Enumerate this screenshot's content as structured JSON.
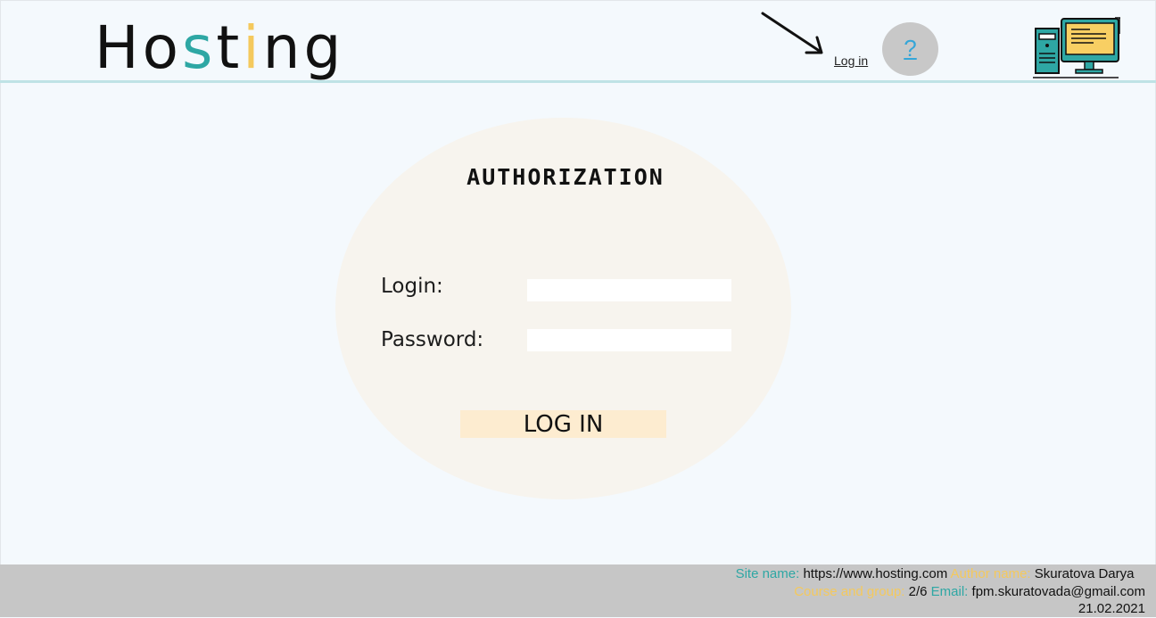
{
  "header": {
    "logo": {
      "part1": "Ho",
      "part2": "s",
      "part3": "t",
      "part4": "i",
      "part5": "ng"
    },
    "login_link": "Log in",
    "help_label": "?"
  },
  "auth": {
    "title": "AUTHORIZATION",
    "login_label": "Login:",
    "login_value": "",
    "password_label": "Password:",
    "password_value": "",
    "submit_label": "LOG IN"
  },
  "footer": {
    "site_label": "Site name:",
    "site_value": "https://www.hosting.com",
    "author_label": "Author name:",
    "author_value": "Skuratova Darya",
    "course_label": "Course and group:",
    "course_value": "2/6",
    "email_label": "Email:",
    "email_value": "fpm.skuratovada@gmail.com",
    "date": "21.02.2021"
  },
  "colors": {
    "accent_teal": "#2ea7a4",
    "accent_yellow": "#f4c95d",
    "help_link_blue": "#35a6d8",
    "submit_bg": "#fdecd0"
  },
  "icons": [
    "arrow-icon",
    "help-icon",
    "computer-icon"
  ]
}
